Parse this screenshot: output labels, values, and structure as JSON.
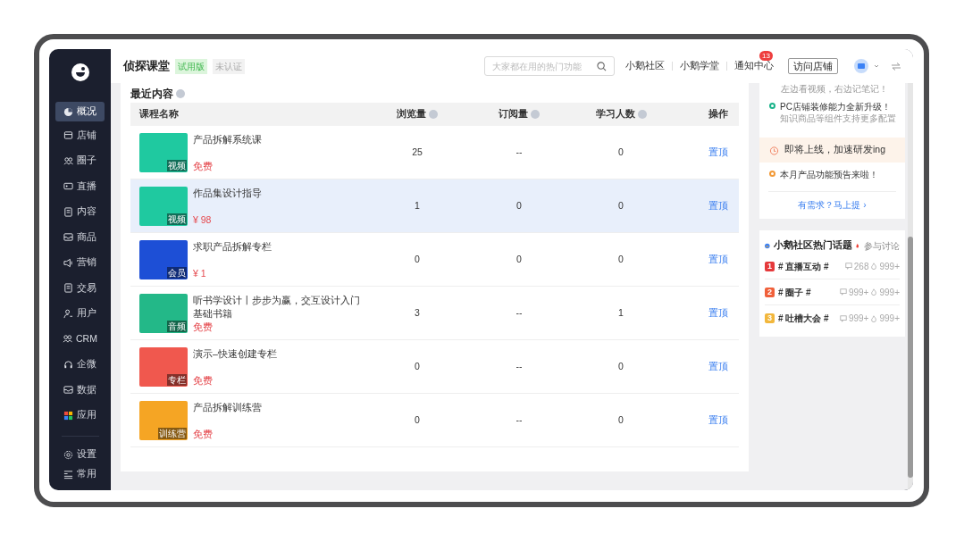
{
  "sidebar": {
    "items": [
      {
        "label": "概况",
        "selected": true
      },
      {
        "label": "店铺",
        "selected": false
      },
      {
        "label": "圈子",
        "selected": false
      },
      {
        "label": "直播",
        "selected": false
      },
      {
        "label": "内容",
        "selected": false
      },
      {
        "label": "商品",
        "selected": false
      },
      {
        "label": "营销",
        "selected": false
      },
      {
        "label": "交易",
        "selected": false
      },
      {
        "label": "用户",
        "selected": false
      },
      {
        "label": "CRM",
        "selected": false
      },
      {
        "label": "企微",
        "selected": false
      },
      {
        "label": "数据",
        "selected": false
      },
      {
        "label": "应用",
        "selected": false
      }
    ],
    "bottom_items": [
      {
        "label": "设置"
      },
      {
        "label": "常用"
      }
    ]
  },
  "header": {
    "shop_name": "侦探课堂",
    "badges": [
      {
        "label": "试用版",
        "kind": "trial"
      },
      {
        "label": "未认证",
        "kind": "plain"
      }
    ],
    "search": {
      "placeholder": "大家都在用的热门功能"
    },
    "links": [
      "小鹅社区",
      "小鹅学堂"
    ],
    "notifications": {
      "label": "通知中心",
      "count": "13"
    },
    "visit_button": "访问店铺"
  },
  "recent": {
    "title": "最近内容",
    "columns": [
      {
        "label": "课程名称",
        "info": false
      },
      {
        "label": "浏览量",
        "info": true
      },
      {
        "label": "订阅量",
        "info": true
      },
      {
        "label": "学习人数",
        "info": true
      },
      {
        "label": "操作",
        "info": false
      }
    ],
    "rows": [
      {
        "title": "产品拆解系统课",
        "price": "免费",
        "thumb_tag": "视频",
        "views": "25",
        "subs": "--",
        "learners": "0",
        "action": "置顶",
        "selected": false
      },
      {
        "title": "作品集设计指导",
        "price": "¥ 98",
        "thumb_tag": "视频",
        "views": "1",
        "subs": "0",
        "learners": "0",
        "action": "置顶",
        "selected": true
      },
      {
        "title": "求职产品拆解专栏",
        "price": "¥ 1",
        "thumb_tag": "会员",
        "views": "0",
        "subs": "0",
        "learners": "0",
        "action": "置顶",
        "selected": false
      },
      {
        "title": "听书学设计丨步步为赢，交互设计入门基础书籍",
        "price": "免费",
        "thumb_tag": "音频",
        "views": "3",
        "subs": "--",
        "learners": "1",
        "action": "置顶",
        "selected": false
      },
      {
        "title": "演示–快速创建专栏",
        "price": "免费",
        "thumb_tag": "专栏",
        "views": "0",
        "subs": "--",
        "learners": "0",
        "action": "置顶",
        "selected": false
      },
      {
        "title": "产品拆解训练营",
        "price": "免费",
        "thumb_tag": "训练营",
        "views": "0",
        "subs": "--",
        "learners": "0",
        "action": "置顶",
        "selected": false
      }
    ]
  },
  "updates": {
    "items": [
      {
        "kind": "cut",
        "text": "左边看视频，右边记笔记！"
      },
      {
        "kind": "item",
        "color": "#1bb38a",
        "text": "PC店铺装修能力全新升级！",
        "sub": "知识商品等组件支持更多配置"
      },
      {
        "kind": "banner",
        "text": "即将上线，加速研发ing"
      },
      {
        "kind": "item",
        "color": "#f29a38",
        "text": "本月产品功能预告来啦！"
      }
    ],
    "link": "有需求？马上提 ›"
  },
  "community": {
    "title": "小鹅社区热门话题",
    "action": "参与讨论",
    "topics": [
      {
        "rank": "1",
        "color": "#e5393b",
        "name": "# 直播互动 #",
        "comments": "268",
        "likes": "999+"
      },
      {
        "rank": "2",
        "color": "#f0603a",
        "name": "# 圈子 #",
        "comments": "999+",
        "likes": "999+"
      },
      {
        "rank": "3",
        "color": "#f2b73c",
        "name": "# 吐槽大会 #",
        "comments": "999+",
        "likes": "999+"
      }
    ]
  }
}
